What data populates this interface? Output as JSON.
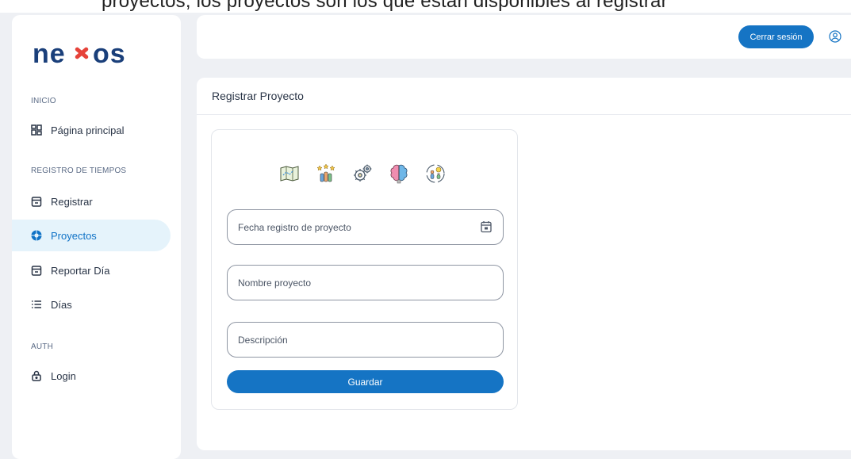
{
  "top_text": "proyectos, los proyectos son los que están disponibles al registrar",
  "brand": {
    "logo_text": "nexos",
    "primary": "#1a3f7a",
    "accent": "#e6433a"
  },
  "sidebar": {
    "sections": [
      {
        "caption": "INICIO"
      },
      {
        "caption": "REGISTRO DE TIEMPOS"
      },
      {
        "caption": "AUTH"
      }
    ],
    "items": [
      {
        "label": "Página principal",
        "icon": "dashboard-icon"
      },
      {
        "label": "Registrar",
        "icon": "calendar-icon"
      },
      {
        "label": "Proyectos",
        "icon": "aperture-icon",
        "active": true
      },
      {
        "label": "Reportar Día",
        "icon": "calendar-icon"
      },
      {
        "label": "Días",
        "icon": "list-icon"
      },
      {
        "label": "Login",
        "icon": "lock-icon"
      }
    ]
  },
  "header": {
    "logout_label": "Cerrar sesión",
    "user_icon": "user-circle-icon"
  },
  "main": {
    "title": "Registrar Proyecto",
    "illustrations": [
      "map-icon",
      "team-stars-icon",
      "gears-icon",
      "brain-icon",
      "idea-people-icon"
    ],
    "fields": [
      {
        "label": "Fecha registro de proyecto",
        "icon": "calendar-icon"
      },
      {
        "label": "Nombre proyecto"
      },
      {
        "label": "Descripción"
      }
    ],
    "save_label": "Guardar"
  },
  "colors": {
    "active_bg": "#e5f3fb",
    "active_text": "#0f72c6",
    "button": "#1574c4"
  }
}
